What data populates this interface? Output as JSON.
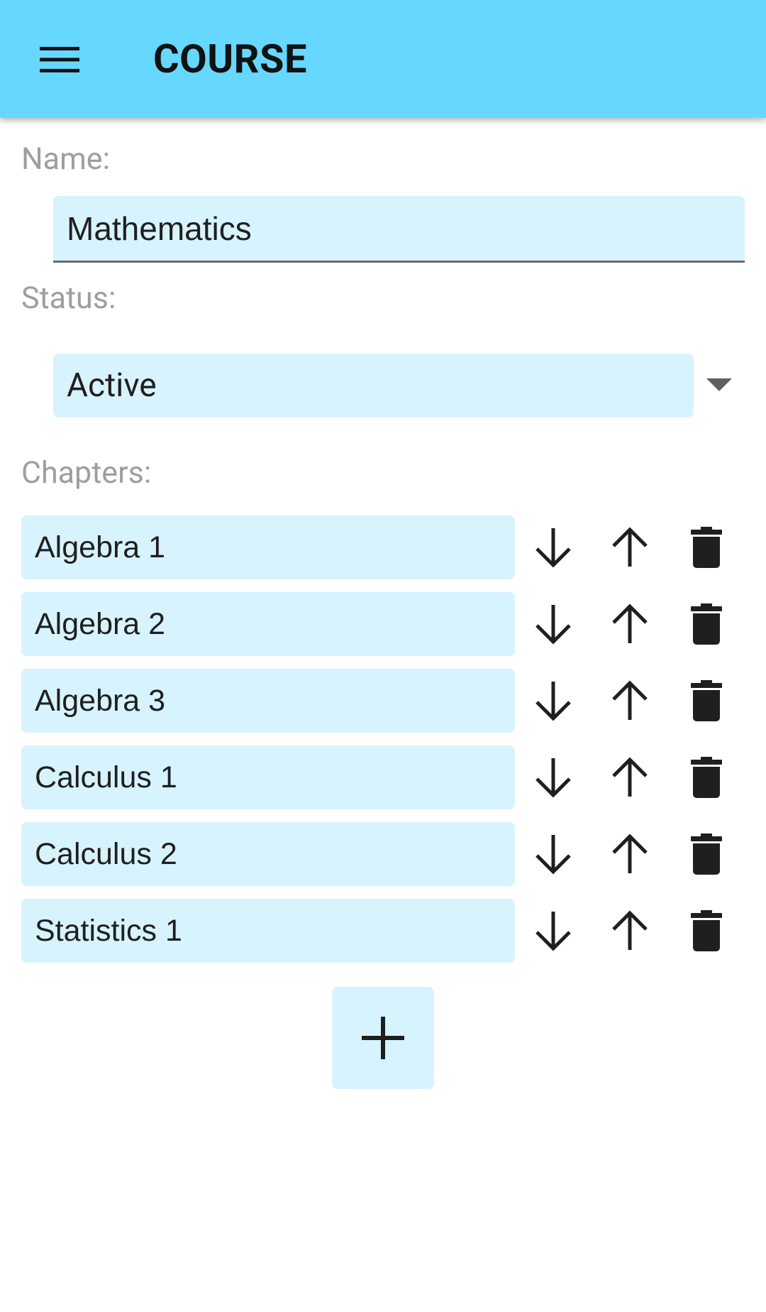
{
  "app_bar": {
    "title": "COURSE",
    "menu_icon": "hamburger-menu-icon",
    "background": "#66d8ff"
  },
  "form": {
    "name_label": "Name:",
    "name_value": "Mathematics",
    "status_label": "Status:",
    "status_value": "Active",
    "chapters_label": "Chapters:"
  },
  "chapters": [
    {
      "label": "Algebra 1"
    },
    {
      "label": "Algebra 2"
    },
    {
      "label": "Algebra 3"
    },
    {
      "label": "Calculus 1"
    },
    {
      "label": "Calculus 2"
    },
    {
      "label": "Statistics 1"
    }
  ],
  "icons": {
    "move_down": "arrow-down-icon",
    "move_up": "arrow-up-icon",
    "delete": "trash-icon",
    "add": "plus-icon"
  },
  "colors": {
    "field_background": "#d7f3fd",
    "label_text": "#9e9e9e",
    "icon": "#1f1f1f"
  }
}
